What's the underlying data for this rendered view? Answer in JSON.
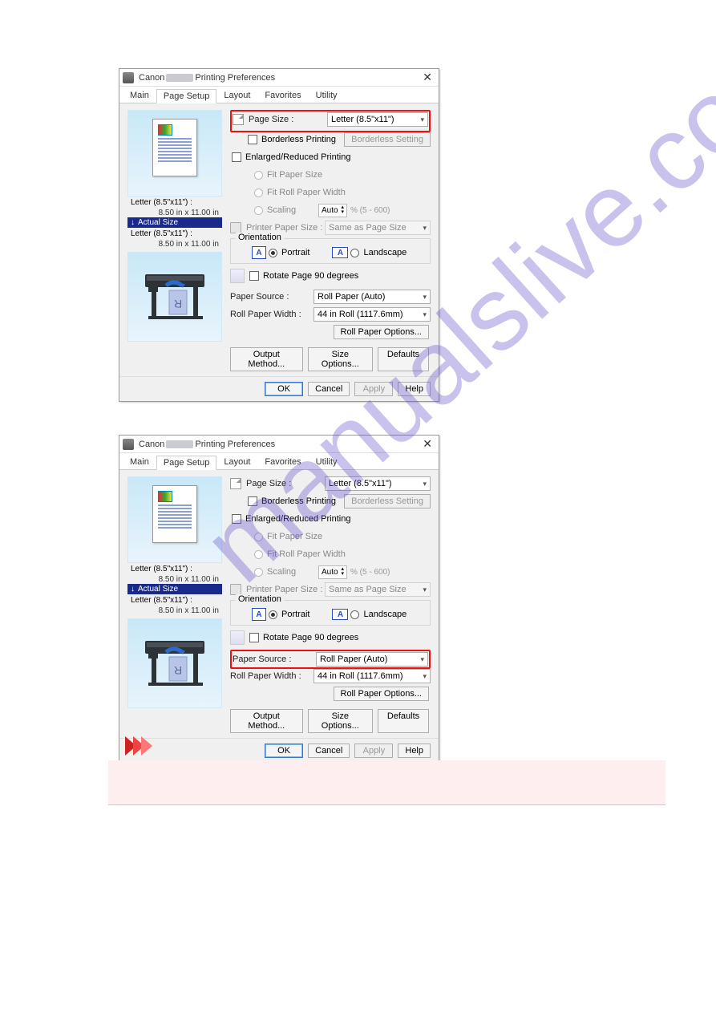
{
  "window_title_prefix": "Canon",
  "window_title_suffix": "Printing Preferences",
  "tabs": [
    "Main",
    "Page Setup",
    "Layout",
    "Favorites",
    "Utility"
  ],
  "active_tab": "Page Setup",
  "page_size_label": "Page Size :",
  "page_size_value": "Letter (8.5\"x11\")",
  "borderless_label": "Borderless Printing",
  "borderless_setting_btn": "Borderless Setting",
  "enlarged_label": "Enlarged/Reduced Printing",
  "fit_paper_size": "Fit Paper Size",
  "fit_roll_width": "Fit Roll Paper Width",
  "scaling_label": "Scaling",
  "scaling_value": "Auto",
  "scaling_range": "%  (5 - 600)",
  "printer_paper_size_label": "Printer Paper Size :",
  "printer_paper_size_value": "Same as Page Size",
  "orientation_label": "Orientation",
  "portrait": "Portrait",
  "landscape": "Landscape",
  "rotate_label": "Rotate Page 90 degrees",
  "paper_source_label": "Paper Source :",
  "paper_source_value": "Roll Paper (Auto)",
  "roll_width_label": "Roll Paper Width :",
  "roll_width_value": "44 in Roll (1117.6mm)",
  "roll_options_btn": "Roll Paper Options...",
  "output_method_btn": "Output Method...",
  "size_options_btn": "Size Options...",
  "defaults_btn": "Defaults",
  "ok_btn": "OK",
  "cancel_btn": "Cancel",
  "apply_btn": "Apply",
  "help_btn": "Help",
  "preview_info_1": "Letter (8.5\"x11\") :",
  "preview_info_1b": "8.50 in x 11.00 in",
  "preview_info_bar": "Actual Size",
  "preview_info_2": "Letter (8.5\"x11\") :",
  "preview_info_2b": "8.50 in x 11.00 in",
  "watermark_text": "manualslive.com"
}
